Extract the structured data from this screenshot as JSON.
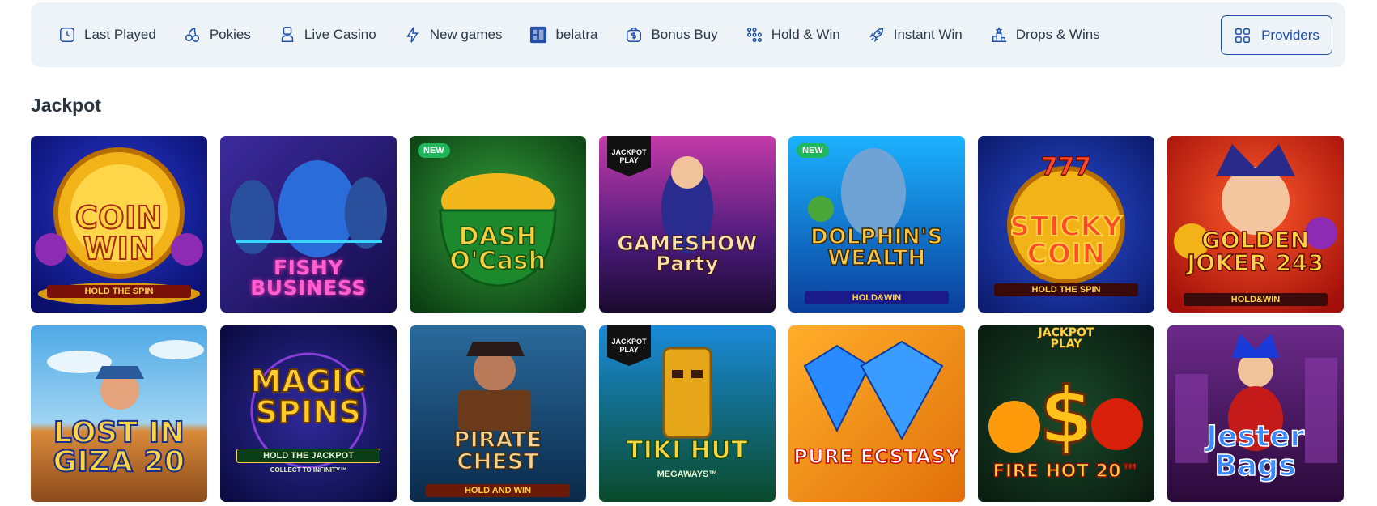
{
  "nav": {
    "items": [
      {
        "label": "Last Played",
        "icon": "clock-icon"
      },
      {
        "label": "Pokies",
        "icon": "cherries-icon"
      },
      {
        "label": "Live Casino",
        "icon": "dealer-icon"
      },
      {
        "label": "New games",
        "icon": "lightning-icon"
      },
      {
        "label": "belatra",
        "icon": "belatra-logo-icon"
      },
      {
        "label": "Bonus Buy",
        "icon": "dollar-bag-icon"
      },
      {
        "label": "Hold & Win",
        "icon": "dots-grid-icon"
      },
      {
        "label": "Instant Win",
        "icon": "rocket-icon"
      },
      {
        "label": "Drops & Wins",
        "icon": "podium-icon"
      }
    ],
    "providers_label": "Providers",
    "accent": "#1f4fa8",
    "bar_bg": "#eef3f7"
  },
  "section": {
    "title": "Jackpot"
  },
  "games": [
    {
      "title": "COIN WIN",
      "subtitle": "HOLD THE SPIN",
      "badge": "",
      "jackpot_tag": "",
      "selected": true
    },
    {
      "title": "FISHY BUSINESS",
      "subtitle": "",
      "badge": "",
      "jackpot_tag": ""
    },
    {
      "title": "DASH O'Cash",
      "subtitle": "",
      "badge": "NEW",
      "jackpot_tag": ""
    },
    {
      "title": "GAMESHOW Party",
      "subtitle": "",
      "badge": "",
      "jackpot_tag": "JACKPOT PLAY"
    },
    {
      "title": "DOLPHIN'S WEALTH",
      "subtitle": "HOLD&WIN",
      "badge": "NEW",
      "jackpot_tag": ""
    },
    {
      "title": "STICKY COIN",
      "subtitle": "HOLD THE SPIN",
      "badge": "",
      "jackpot_tag": "",
      "top_text": "777"
    },
    {
      "title": "GOLDEN JOKER 243",
      "subtitle": "HOLD&WIN",
      "badge": "",
      "jackpot_tag": ""
    },
    {
      "title": "LOST IN GIZA 20",
      "subtitle": "",
      "badge": "",
      "jackpot_tag": ""
    },
    {
      "title": "MAGIC SPINS",
      "subtitle": "HOLD THE JACKPOT",
      "subtitle2": "COLLECT TO INFINITY™",
      "badge": "",
      "jackpot_tag": ""
    },
    {
      "title": "PIRATE CHEST",
      "subtitle": "HOLD AND WIN",
      "badge": "",
      "jackpot_tag": ""
    },
    {
      "title": "TIKI HUT",
      "subtitle": "MEGAWAYS™",
      "badge": "",
      "jackpot_tag": "JACKPOT PLAY"
    },
    {
      "title": "PURE ECSTASY",
      "subtitle": "",
      "badge": "",
      "jackpot_tag": ""
    },
    {
      "title": "FIRE HOT 20™",
      "subtitle": "",
      "badge": "",
      "jackpot_tag": "",
      "top_text": "JACKPOT PLAY"
    },
    {
      "title": "Jester Bags",
      "subtitle": "",
      "badge": "",
      "jackpot_tag": ""
    }
  ]
}
